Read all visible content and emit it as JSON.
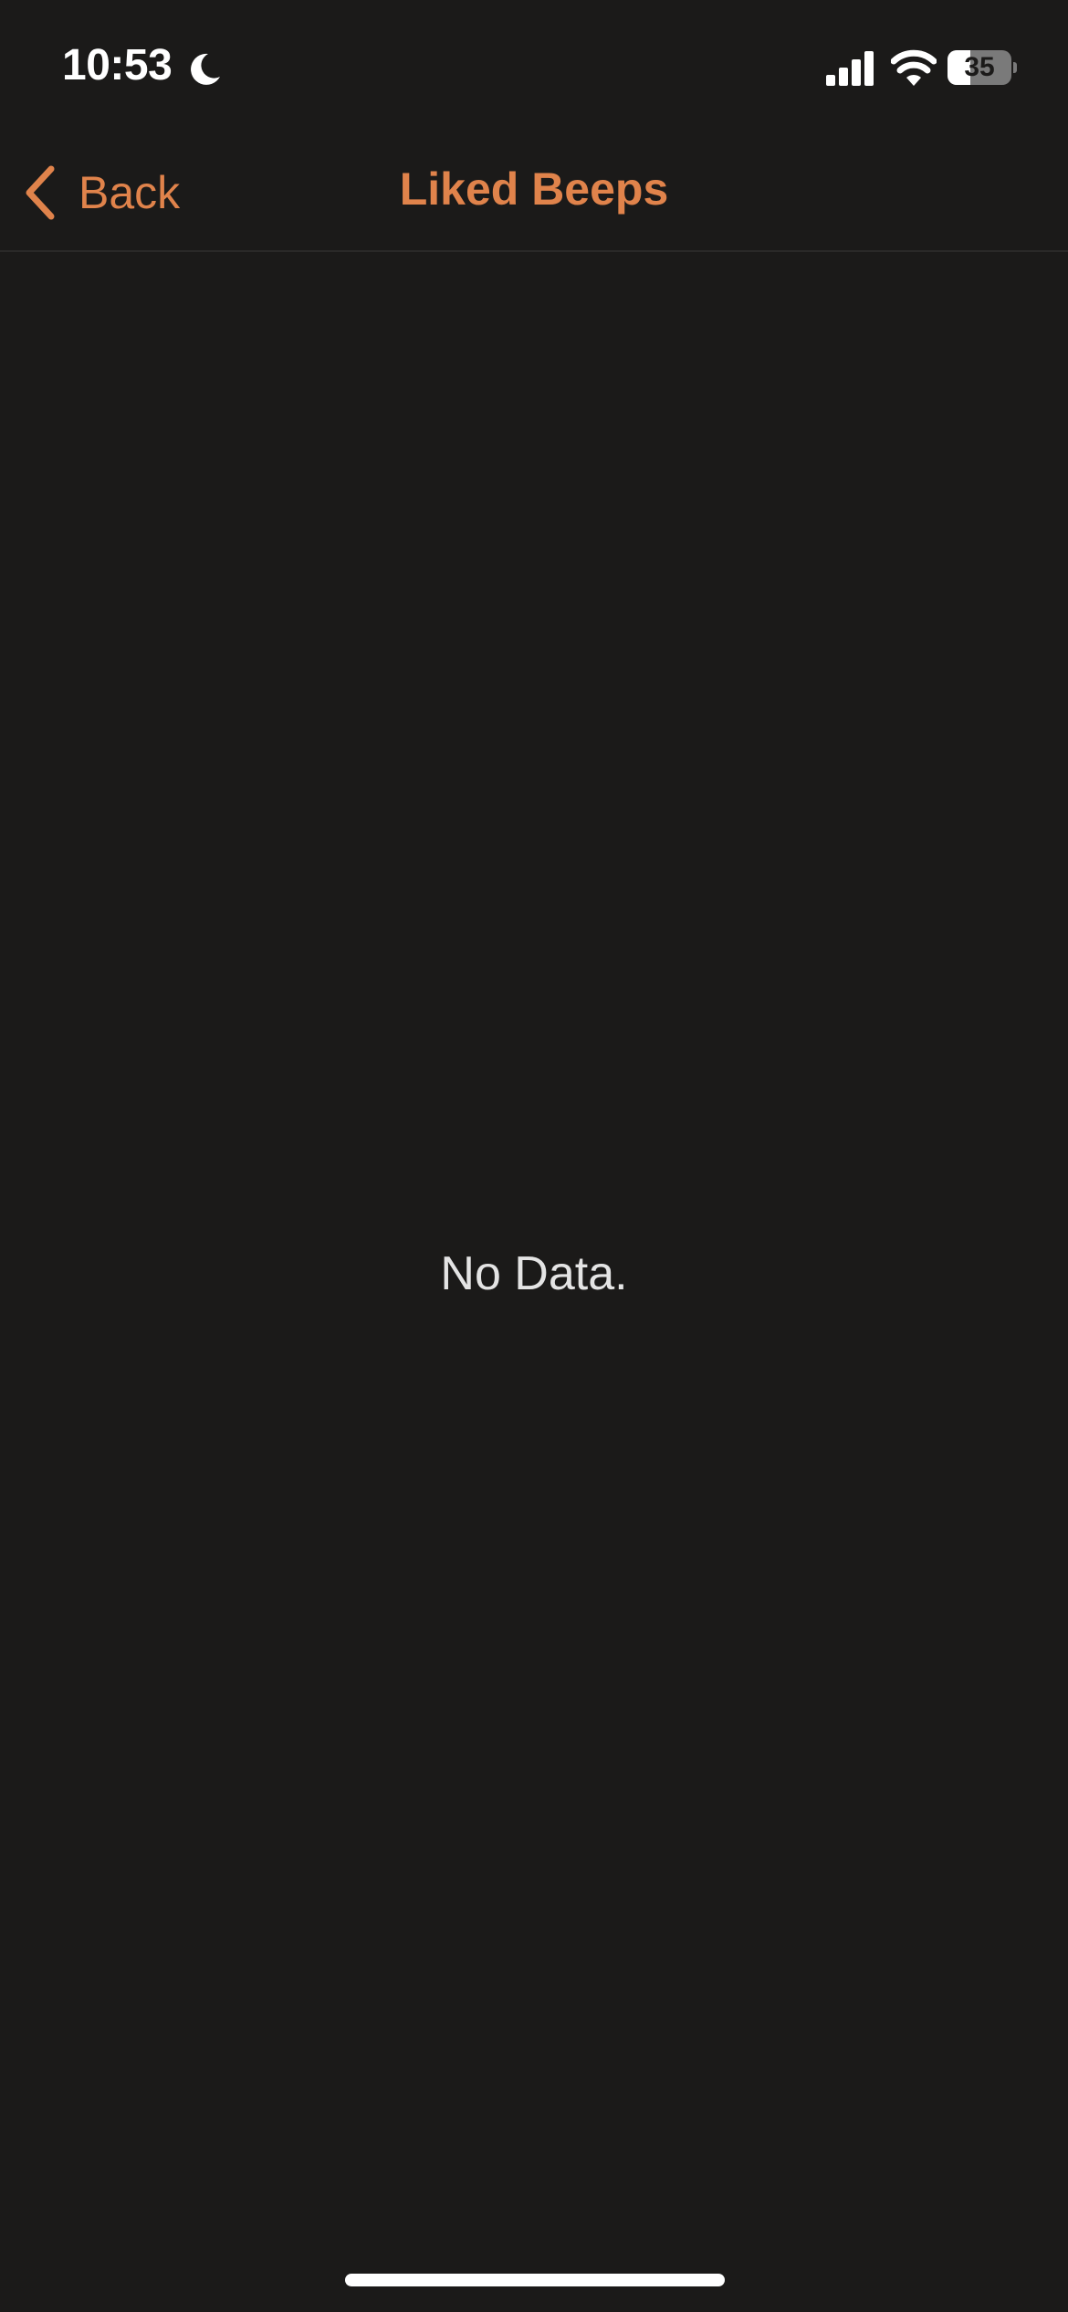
{
  "status_bar": {
    "time": "10:53",
    "battery_level": "35",
    "battery_fraction": 0.35,
    "icons": [
      "moon-icon",
      "cellular-signal-icon",
      "wifi-icon",
      "battery-icon"
    ]
  },
  "nav": {
    "back_label": "Back",
    "title": "Liked Beeps"
  },
  "content": {
    "empty_message": "No Data."
  },
  "colors": {
    "background": "#1b1a19",
    "accent": "#e0834b",
    "text": "#e4e4e4"
  }
}
